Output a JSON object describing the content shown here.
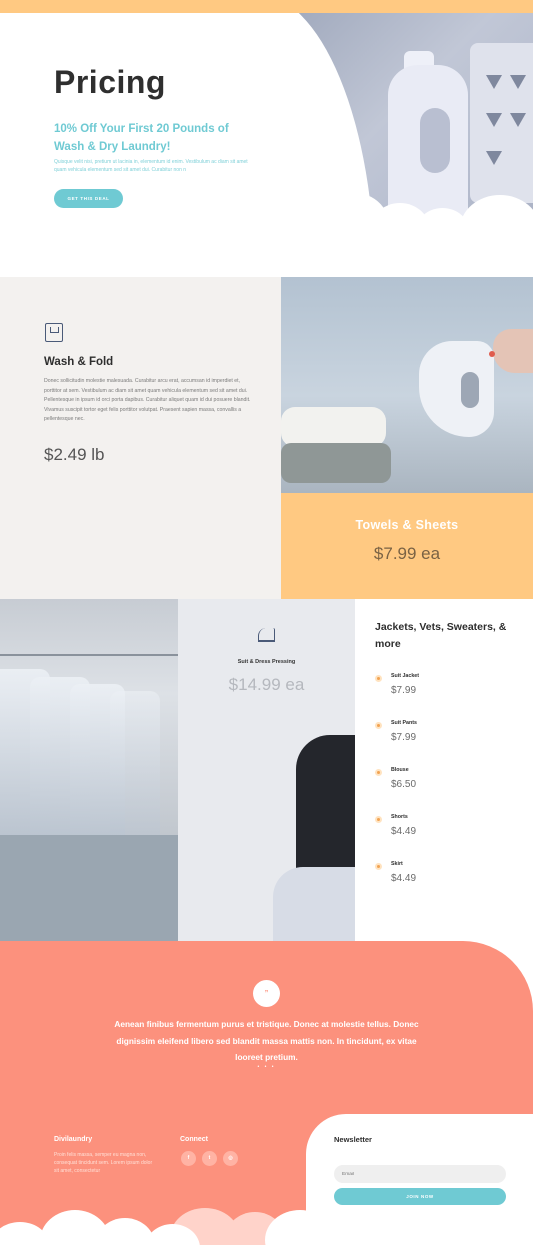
{
  "colors": {
    "accent_teal": "#6fcad3",
    "accent_orange": "#ffc982",
    "accent_coral": "#fc917d",
    "text_dark": "#2e2e2e"
  },
  "hero": {
    "title": "Pricing",
    "subtitle": "10% Off Your First 20 Pounds of Wash & Dry Laundry!",
    "body": "Quisque velit nisi, pretium ut lacinia in, elementum id enim. Vestibulum ac diam sit amet quam vehicula elementum sed sit amet dui. Curabitur non n",
    "button": "GET THIS DEAL"
  },
  "wash_fold": {
    "icon": "shirt-icon",
    "title": "Wash & Fold",
    "body": "Donec sollicitudin molestie malesuada. Curabitur arcu erat, accumsan id imperdiet et, porttitor at sem. Vestibulum ac diam sit amet quam vehicula elementum sed sit amet dui. Pellentesque in ipsum id orci porta dapibus. Curabitur aliquet quam id dui posuere blandit. Vivamus suscipit tortor eget felis porttitor volutpat. Praesent sapien massa, convallis a pellentesque nec.",
    "price": "$2.49 lb"
  },
  "towels": {
    "title": "Towels & Sheets",
    "price": "$7.99 ea"
  },
  "pressing": {
    "icon": "iron-icon",
    "title": "Suit & Dress Pressing",
    "price": "$14.99 ea"
  },
  "jackets": {
    "title": "Jackets, Vets, Sweaters, & more",
    "items": [
      {
        "name": "Suit Jacket",
        "price": "$7.99"
      },
      {
        "name": "Suit Pants",
        "price": "$7.99"
      },
      {
        "name": "Blouse",
        "price": "$6.50"
      },
      {
        "name": "Shorts",
        "price": "$4.49"
      },
      {
        "name": "Skirt",
        "price": "$4.49"
      }
    ]
  },
  "testimonial": {
    "badge": "”",
    "quote": "Aenean finibus fermentum purus et tristique. Donec at molestie tellus. Donec dignissim eleifend libero sed blandit massa mattis non. In tincidunt, ex vitae looreet pretium.",
    "dots": "• • •"
  },
  "footer": {
    "brand": "Divilaundry",
    "brand_text": "Proin felis massa, semper eu magna non, consequat tincidunt sem. Lorem ipsum dolor sit amet, consectetur",
    "connect": "Connect",
    "social": [
      {
        "icon": "facebook-icon",
        "glyph": "f"
      },
      {
        "icon": "twitter-icon",
        "glyph": "t"
      },
      {
        "icon": "instagram-icon",
        "glyph": "◎"
      }
    ],
    "newsletter_title": "Newsletter",
    "email_placeholder": "Email",
    "join_button": "JOIN NOW"
  }
}
